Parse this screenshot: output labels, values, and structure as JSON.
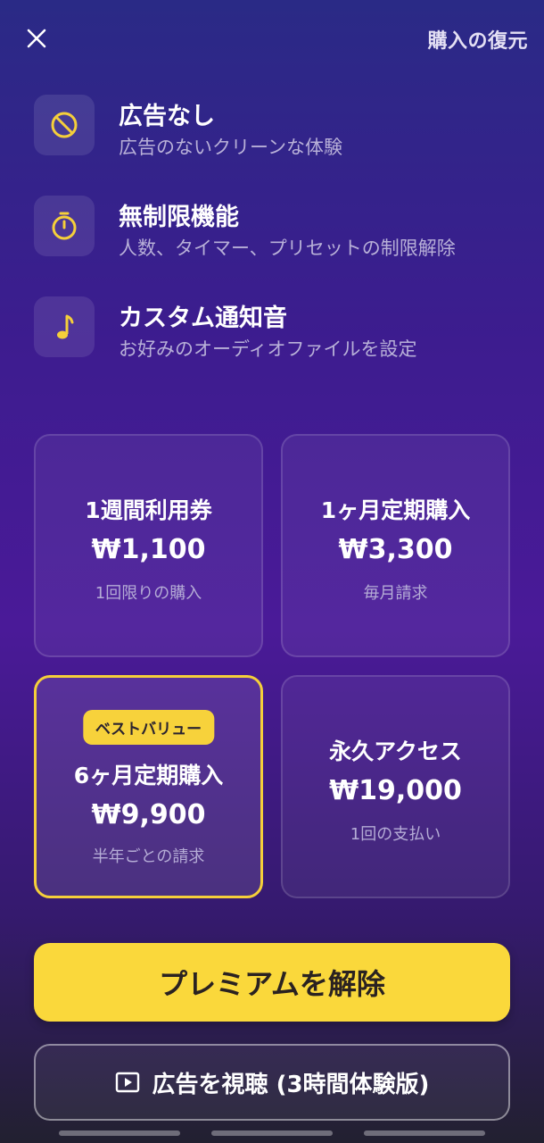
{
  "header": {
    "restore_label": "購入の復元",
    "close_icon": "close-icon"
  },
  "features": [
    {
      "icon": "no-ads-icon",
      "title": "広告なし",
      "subtitle": "広告のないクリーンな体験"
    },
    {
      "icon": "timer-icon",
      "title": "無制限機能",
      "subtitle": "人数、タイマー、プリセットの制限解除"
    },
    {
      "icon": "music-note-icon",
      "title": "カスタム通知音",
      "subtitle": "お好みのオーディオファイルを設定"
    }
  ],
  "plans": [
    {
      "name": "1週間利用券",
      "price": "₩1,100",
      "note": "1回限りの購入"
    },
    {
      "name": "1ヶ月定期購入",
      "price": "₩3,300",
      "note": "毎月請求"
    },
    {
      "name": "6ヶ月定期購入",
      "price": "₩9,900",
      "note": "半年ごとの請求",
      "badge": "ベストバリュー"
    },
    {
      "name": "永久アクセス",
      "price": "₩19,000",
      "note": "1回の支払い"
    }
  ],
  "actions": {
    "unlock_label": "プレミアムを解除",
    "watch_ad_label": "広告を視聴 (3時間体験版)"
  },
  "colors": {
    "accent": "#fad83b",
    "icon_yellow": "#f5cf3a"
  }
}
